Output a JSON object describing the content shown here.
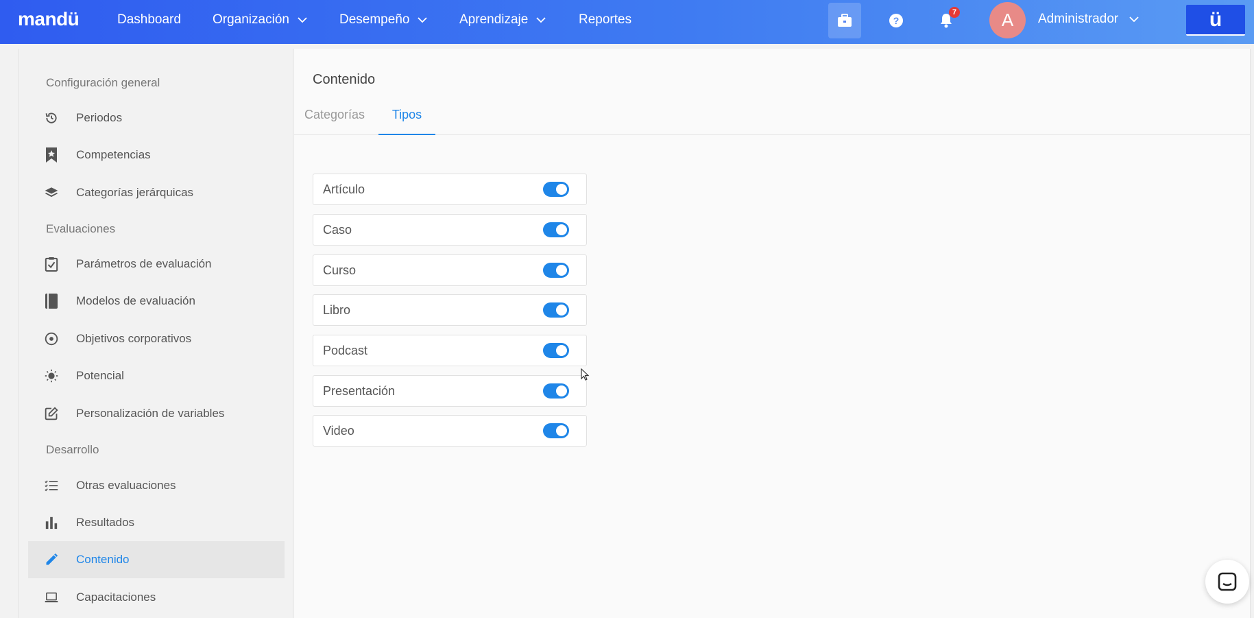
{
  "header": {
    "logo": "mandü",
    "nav": [
      {
        "label": "Dashboard"
      },
      {
        "label": "Organización"
      },
      {
        "label": "Desempeño"
      },
      {
        "label": "Aprendizaje"
      },
      {
        "label": "Reportes"
      }
    ],
    "notification_count": "7",
    "avatar_initial": "A",
    "user_name": "Administrador",
    "brand_button": "ü"
  },
  "sidebar": {
    "sections": [
      {
        "label": "Configuración general"
      },
      {
        "label": "Evaluaciones"
      },
      {
        "label": "Desarrollo"
      }
    ],
    "items": [
      {
        "label": "Periodos",
        "icon": "history-icon"
      },
      {
        "label": "Competencias",
        "icon": "bookmark-star-icon"
      },
      {
        "label": "Categorías jerárquicas",
        "icon": "layers-icon"
      },
      {
        "label": "Parámetros de evaluación",
        "icon": "clipboard-check-icon"
      },
      {
        "label": "Modelos de evaluación",
        "icon": "book-icon"
      },
      {
        "label": "Objetivos corporativos",
        "icon": "target-icon"
      },
      {
        "label": "Potencial",
        "icon": "sun-icon"
      },
      {
        "label": "Personalización de variables",
        "icon": "edit-square-icon"
      },
      {
        "label": "Otras evaluaciones",
        "icon": "checklist-icon"
      },
      {
        "label": "Resultados",
        "icon": "bar-chart-icon"
      },
      {
        "label": "Contenido",
        "icon": "pencil-icon",
        "active": true
      },
      {
        "label": "Capacitaciones",
        "icon": "laptop-icon"
      }
    ]
  },
  "main": {
    "title": "Contenido",
    "tabs": [
      {
        "label": "Categorías"
      },
      {
        "label": "Tipos",
        "active": true
      }
    ],
    "types": [
      {
        "label": "Artículo",
        "enabled": true
      },
      {
        "label": "Caso",
        "enabled": true
      },
      {
        "label": "Curso",
        "enabled": true
      },
      {
        "label": "Libro",
        "enabled": true
      },
      {
        "label": "Podcast",
        "enabled": true
      },
      {
        "label": "Presentación",
        "enabled": true
      },
      {
        "label": "Video",
        "enabled": true
      }
    ]
  },
  "colors": {
    "accent": "#1f86e8",
    "header_start": "#2f5cf0",
    "header_end": "#5a9bf3",
    "avatar": "#e88a87",
    "badge": "#e53935"
  }
}
